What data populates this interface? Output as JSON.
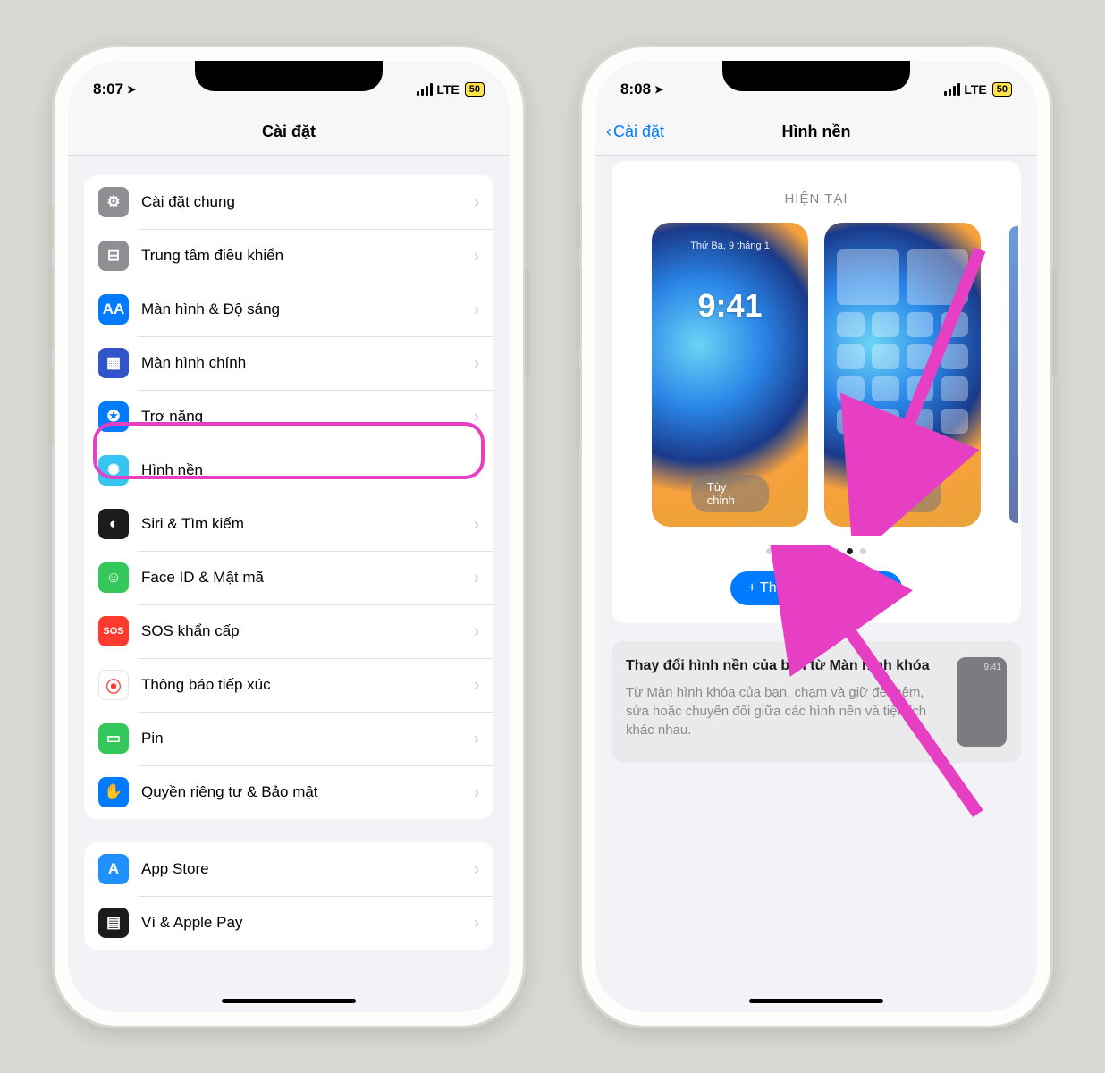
{
  "left": {
    "status": {
      "time": "8:07",
      "net": "LTE",
      "batt": "50"
    },
    "title": "Cài đặt",
    "group1": [
      {
        "name": "general",
        "label": "Cài đặt chung",
        "bg": "#8e8e93",
        "glyph": "⚙"
      },
      {
        "name": "control-center",
        "label": "Trung tâm điều khiển",
        "bg": "#8e8e93",
        "glyph": "⊟"
      },
      {
        "name": "display",
        "label": "Màn hình & Độ sáng",
        "bg": "#007aff",
        "glyph": "AA"
      },
      {
        "name": "homescreen",
        "label": "Màn hình chính",
        "bg": "#3154c9",
        "glyph": "▦"
      },
      {
        "name": "accessibility",
        "label": "Trợ năng",
        "bg": "#007aff",
        "glyph": "✪"
      },
      {
        "name": "wallpaper",
        "label": "Hình nền",
        "bg": "#36c5f0",
        "glyph": "✺"
      },
      {
        "name": "siri",
        "label": "Siri & Tìm kiếm",
        "bg": "#1c1c1e",
        "glyph": "◐"
      },
      {
        "name": "faceid",
        "label": "Face ID & Mật mã",
        "bg": "#34c759",
        "glyph": "☺"
      },
      {
        "name": "sos",
        "label": "SOS khẩn cấp",
        "bg": "#ff3b30",
        "glyph": "SOS"
      },
      {
        "name": "exposure",
        "label": "Thông báo tiếp xúc",
        "bg": "#ffffff",
        "glyph": "⦿",
        "fg": "#ff3b30",
        "border": "#e5e5ea"
      },
      {
        "name": "battery",
        "label": "Pin",
        "bg": "#34c759",
        "glyph": "▭"
      },
      {
        "name": "privacy",
        "label": "Quyền riêng tư & Bảo mật",
        "bg": "#007aff",
        "glyph": "✋"
      }
    ],
    "group2": [
      {
        "name": "appstore",
        "label": "App Store",
        "bg": "#1e90ff",
        "glyph": "A"
      },
      {
        "name": "wallet",
        "label": "Ví & Apple Pay",
        "bg": "#1c1c1e",
        "glyph": "▤"
      }
    ]
  },
  "right": {
    "status": {
      "time": "8:08",
      "net": "LTE",
      "batt": "50"
    },
    "back": "Cài đặt",
    "title": "Hình nền",
    "section": "HIỆN TẠI",
    "lock_date": "Thứ Ba, 9 tháng 1",
    "lock_time": "9:41",
    "customize": "Tùy chỉnh",
    "add_new": "+ Thêm hình nền mới",
    "tip_head": "Thay đổi hình nền của bạn từ Màn hình khóa",
    "tip_body": "Từ Màn hình khóa của bạn, chạm và giữ để thêm, sửa hoặc chuyển đổi giữa các hình nền và tiện ích khác nhau.",
    "tip_time": "9:41",
    "active_dot": 6,
    "dot_count": 8
  },
  "annotation": {
    "color": "#e73fc4"
  }
}
